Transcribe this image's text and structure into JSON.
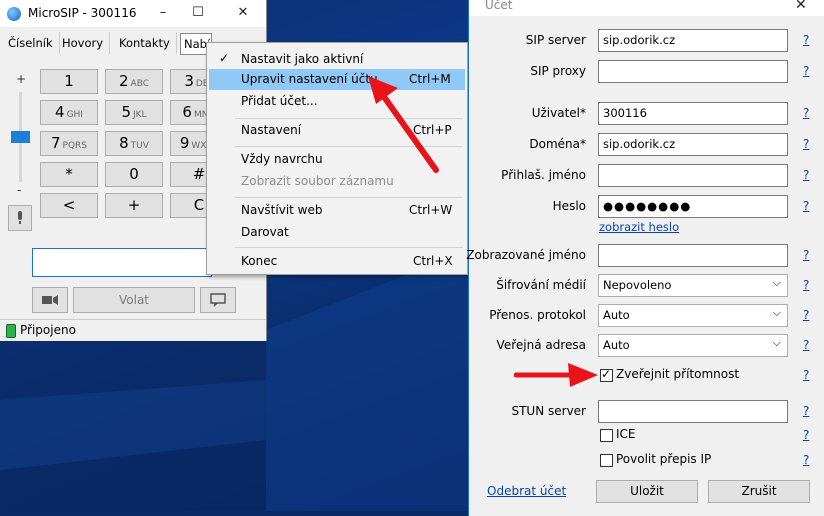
{
  "microsip": {
    "title": "MicroSIP - 300116",
    "window_buttons": {
      "minimize": "–",
      "maximize": "☐",
      "close": "✕"
    },
    "tabs": [
      "Číselník",
      "Hovory",
      "Kontakty",
      "Nabídka"
    ],
    "volume": {
      "plus": "+",
      "minus": "-",
      "level": 0.55
    },
    "keys": [
      {
        "main": "1",
        "sub": ""
      },
      {
        "main": "2",
        "sub": "ABC"
      },
      {
        "main": "3",
        "sub": "DEF"
      },
      {
        "main": "4",
        "sub": "GHI"
      },
      {
        "main": "5",
        "sub": "JKL"
      },
      {
        "main": "6",
        "sub": "MNO"
      },
      {
        "main": "7",
        "sub": "PQRS"
      },
      {
        "main": "8",
        "sub": "TUV"
      },
      {
        "main": "9",
        "sub": "WXYZ"
      },
      {
        "main": "*",
        "sub": ""
      },
      {
        "main": "0",
        "sub": ""
      },
      {
        "main": "#",
        "sub": ""
      },
      {
        "main": "<",
        "sub": ""
      },
      {
        "main": "+",
        "sub": ""
      },
      {
        "main": "C",
        "sub": ""
      }
    ],
    "number_value": "",
    "call_button": "Volat",
    "status": "Připojeno"
  },
  "menu": {
    "items": [
      {
        "label": "Nastavit jako aktivní",
        "shortcut": "",
        "checked": true
      },
      {
        "label": "Upravit nastavení účtu",
        "shortcut": "Ctrl+M",
        "highlighted": true
      },
      {
        "label": "Přidat účet...",
        "shortcut": ""
      },
      {
        "label": "Nastavení",
        "shortcut": "Ctrl+P"
      },
      {
        "label": "Vždy navrchu",
        "shortcut": ""
      },
      {
        "label": "Zobrazit soubor záznamu",
        "shortcut": "",
        "disabled": true
      },
      {
        "label": "Navštívit web",
        "shortcut": "Ctrl+W"
      },
      {
        "label": "Darovat",
        "shortcut": ""
      },
      {
        "label": "Konec",
        "shortcut": "Ctrl+X"
      }
    ]
  },
  "account": {
    "title": "Účet",
    "close": "✕",
    "help": "?",
    "fields": {
      "sip_server": {
        "label": "SIP server",
        "value": "sip.odorik.cz"
      },
      "sip_proxy": {
        "label": "SIP proxy",
        "value": ""
      },
      "user": {
        "label": "Uživatel*",
        "value": "300116"
      },
      "domain": {
        "label": "Doména*",
        "value": "sip.odorik.cz"
      },
      "login": {
        "label": "Přihlaš. jméno",
        "value": ""
      },
      "password": {
        "label": "Heslo",
        "value": "●●●●●●●●"
      },
      "show_password": "zobrazit heslo",
      "display_name": {
        "label": "Zobrazované jméno",
        "value": ""
      },
      "media_encryption": {
        "label": "Šifrování médií",
        "value": "Nepovoleno"
      },
      "transport": {
        "label": "Přenos. protokol",
        "value": "Auto"
      },
      "public_address": {
        "label": "Veřejná adresa",
        "value": "Auto"
      },
      "publish_presence": {
        "label": "Zveřejnit přítomnost",
        "checked": true
      },
      "stun_server": {
        "label": "STUN server",
        "value": ""
      },
      "ice": {
        "label": "ICE",
        "checked": false
      },
      "rewrite": {
        "label": "Povolit přepis IP",
        "checked": false
      }
    },
    "remove_link": "Odebrat účet",
    "save": "Uložit",
    "cancel": "Zrušit"
  },
  "colors": {
    "arrow": "#e8141a",
    "highlight": "#90c8f6",
    "led": "#2cb24a"
  }
}
